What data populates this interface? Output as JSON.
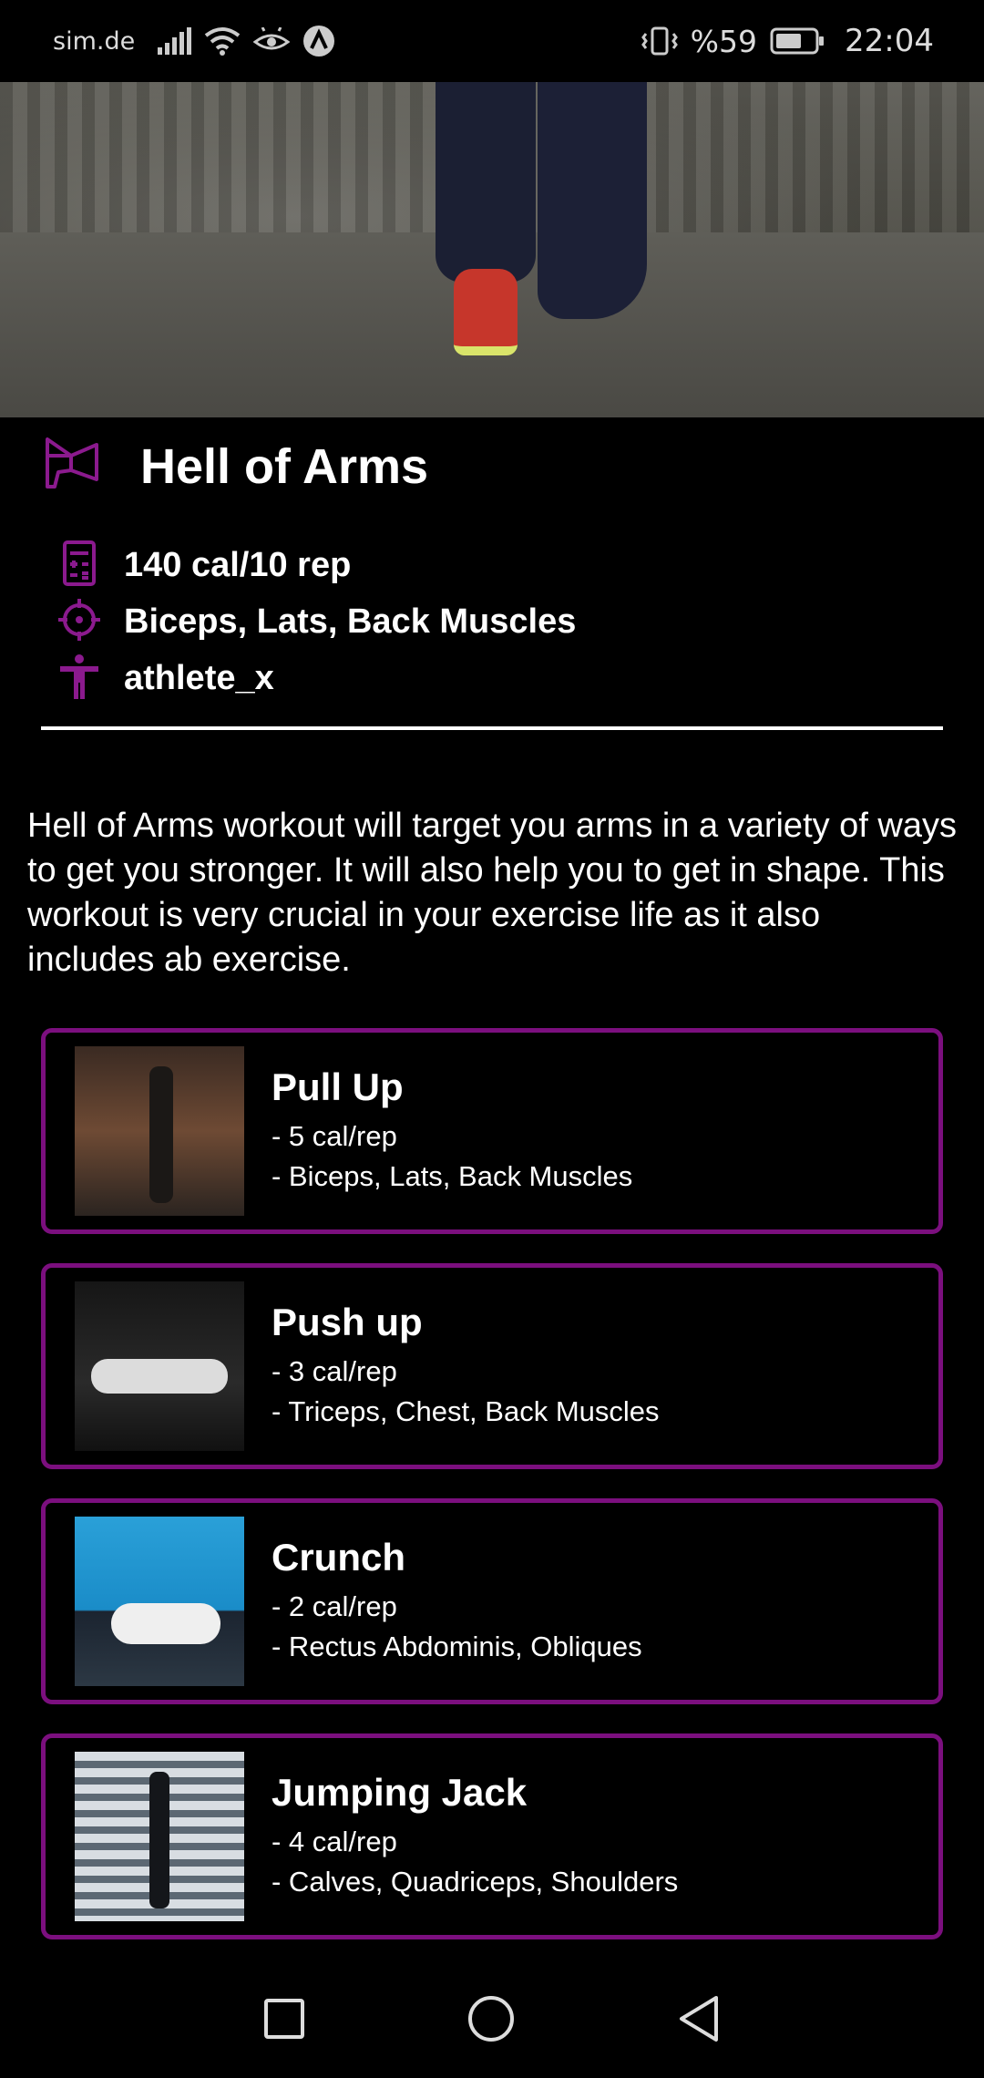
{
  "status_bar": {
    "carrier": "sim.de",
    "battery": "%59",
    "time": "22:04"
  },
  "workout": {
    "title": "Hell of Arms",
    "calories": "140 cal/10 rep",
    "muscles": "Biceps, Lats, Back Muscles",
    "author": "athlete_x",
    "description": "Hell of Arms workout will target you arms in a variety of ways to get you stronger. It will also help you to get in shape. This workout is very crucial in your exercise life as it also includes ab exercise."
  },
  "exercises": [
    {
      "name": "Pull Up",
      "calories": "- 5 cal/rep",
      "muscles": "- Biceps, Lats, Back Muscles"
    },
    {
      "name": "Push up",
      "calories": "- 3 cal/rep",
      "muscles": "- Triceps, Chest, Back Muscles"
    },
    {
      "name": "Crunch",
      "calories": "- 2 cal/rep",
      "muscles": "- Rectus Abdominis, Obliques"
    },
    {
      "name": "Jumping Jack",
      "calories": "- 4 cal/rep",
      "muscles": "- Calves, Quadriceps, Shoulders"
    }
  ],
  "colors": {
    "accent": "#7b0f7e",
    "background": "#000000",
    "text": "#ffffff"
  },
  "icons": {
    "title": "megaphone-icon",
    "calories": "calculator-icon",
    "muscles": "target-icon",
    "author": "person-icon"
  }
}
